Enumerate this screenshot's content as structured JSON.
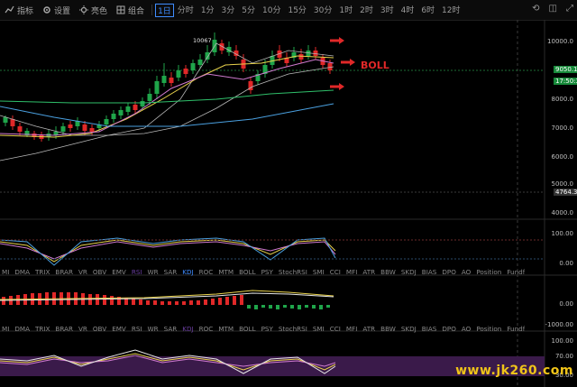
{
  "toolbar": {
    "indicators_label": "指标",
    "settings_label": "设置",
    "color_label": "亮色",
    "combo_label": "组合",
    "timeframes": [
      "1日",
      "分时",
      "1分",
      "3分",
      "5分",
      "10分",
      "15分",
      "30分",
      "1时",
      "2时",
      "3时",
      "4时",
      "6时",
      "12时"
    ],
    "active_timeframe": "1日"
  },
  "price_axis": {
    "ticks": [
      "10000.0",
      "9000.0",
      "8000.0",
      "7000.0",
      "6000.0",
      "5000.0",
      "4000.0"
    ],
    "current_price": "9050.1",
    "countdown": "17:50:3",
    "low_marker": "4764.3",
    "peak_label": "10067"
  },
  "annotation": {
    "boll_label": "BOLL"
  },
  "indicator_rows": [
    [
      "MI",
      "DMA",
      "TRIX",
      "BRAR",
      "VR",
      "OBV",
      "EMV",
      "RSI",
      "WR",
      "SAR",
      "KDJ",
      "ROC",
      "MTM",
      "BOLL",
      "PSY",
      "StochRSI",
      "SMI",
      "CCI",
      "MFI",
      "ATR",
      "BBW",
      "SKDJ",
      "BIAS",
      "DPO",
      "AO",
      "Position",
      "Fundflow"
    ],
    [
      "MI",
      "DMA",
      "TRIX",
      "BRAR",
      "VR",
      "OBV",
      "EMV",
      "RSI",
      "WR",
      "SAR",
      "KDJ",
      "ROC",
      "MTM",
      "BOLL",
      "PSY",
      "StochRSI",
      "SMI",
      "CCI",
      "MFI",
      "ATR",
      "BBW",
      "SKDJ",
      "BIAS",
      "DPO",
      "AO",
      "Position",
      "Fundflow"
    ]
  ],
  "indicator_active": [
    "KDJ",
    "MACD"
  ],
  "panel_axes": {
    "kdj": [
      "100.00",
      "0.00"
    ],
    "macd": [
      "0.00",
      "-1000.00"
    ],
    "rsi": [
      "100.00",
      "70.00",
      "30.00"
    ]
  },
  "watermark": "www.jk260.com",
  "colors": {
    "up": "#1fa54a",
    "down": "#e02828",
    "accent": "#3f8cff",
    "boll_upper": "#b8b8b8",
    "ma_yellow": "#e8d24c",
    "ma_purple": "#d07ad0",
    "ma_green": "#2fbf6a",
    "ma_blue": "#4aa0e0"
  }
}
